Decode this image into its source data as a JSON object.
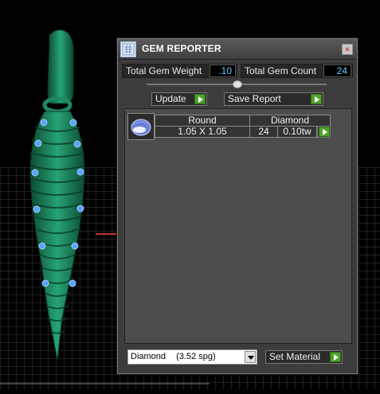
{
  "window": {
    "title": "GEM REPORTER",
    "close_glyph": "×"
  },
  "totals": {
    "weight_label": "Total Gem Weight",
    "weight_value": ".10",
    "count_label": "Total Gem Count",
    "count_value": "24"
  },
  "actions": {
    "update_label": "Update",
    "save_label": "Save Report"
  },
  "gems": [
    {
      "shape": "Round",
      "type": "Diamond",
      "size": "1.05 X 1.05",
      "count": "24",
      "weight": "0.10tw"
    }
  ],
  "material": {
    "name": "Diamond",
    "spg": "(3.52 spg)",
    "set_label": "Set Material"
  },
  "colors": {
    "value_text": "#5cd0ff",
    "accent_green": "#4fa22e",
    "model_green": "#1f8b5f",
    "gem_blue": "#5aa3ff"
  },
  "icons": [
    "app-icon",
    "close-icon",
    "collapse-icon",
    "gem-thumb-icon",
    "dropdown-arrow-icon"
  ]
}
